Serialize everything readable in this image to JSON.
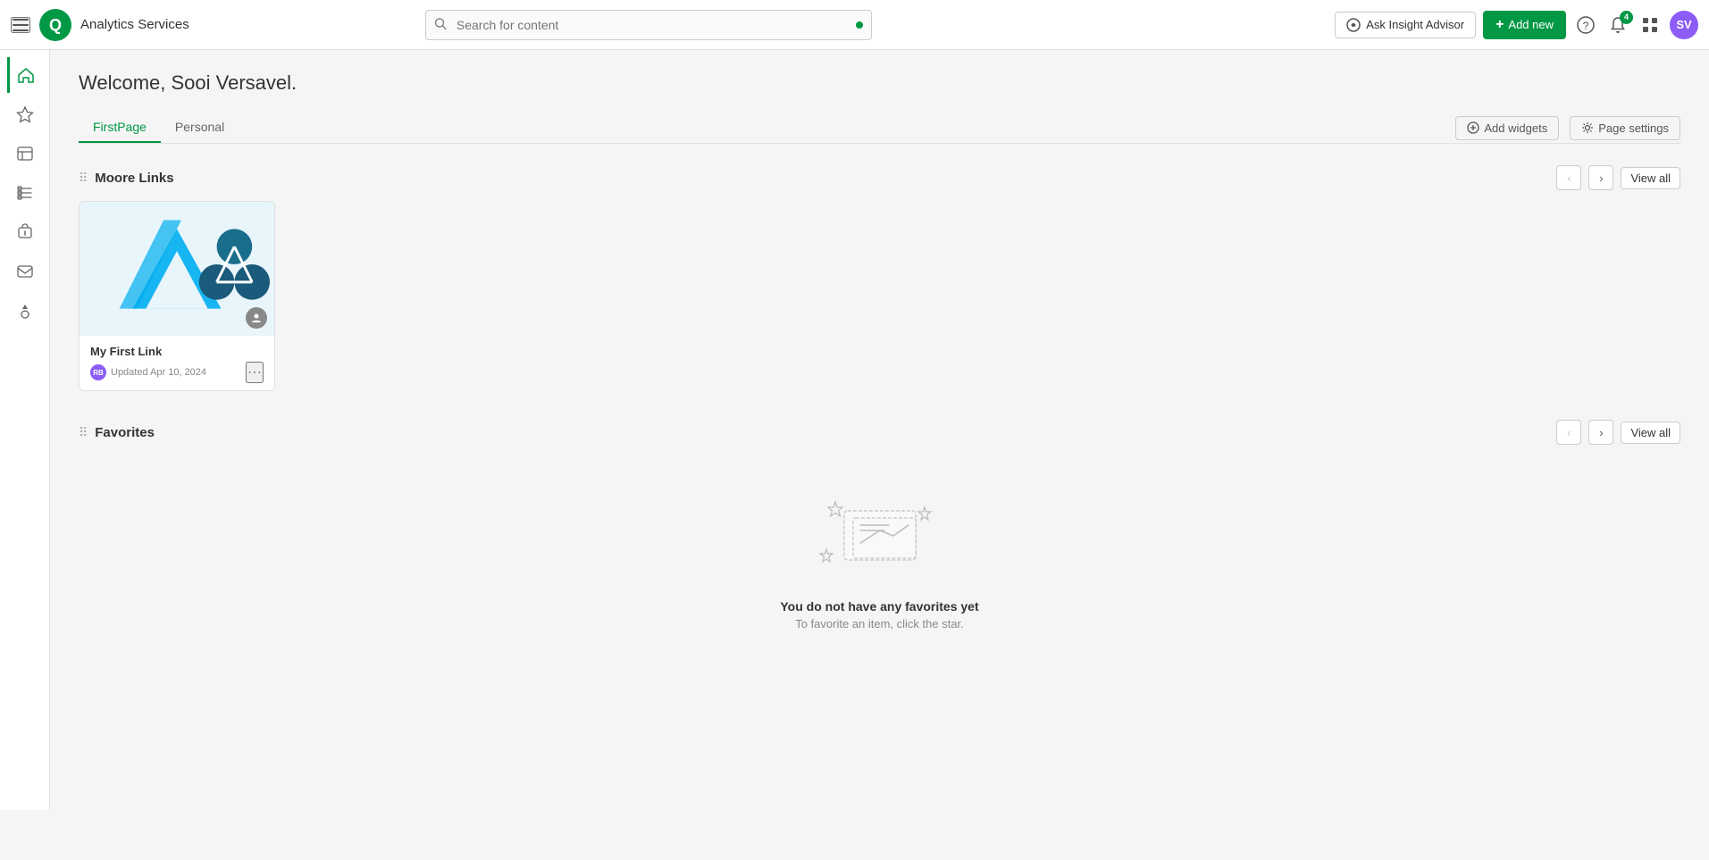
{
  "topnav": {
    "app_title": "Analytics Services",
    "search_placeholder": "Search for content",
    "insight_advisor_label": "Ask Insight Advisor",
    "add_new_label": "Add new",
    "notification_badge": "4",
    "avatar_initials": "SV"
  },
  "sidebar": {
    "items": [
      {
        "id": "home",
        "label": "Home",
        "icon": "⌂",
        "active": true
      },
      {
        "id": "starred",
        "label": "Starred",
        "icon": "☆",
        "active": false
      },
      {
        "id": "catalog",
        "label": "Catalog",
        "icon": "▦",
        "active": false
      },
      {
        "id": "collections",
        "label": "Collections",
        "icon": "🔖",
        "active": false
      },
      {
        "id": "alerts",
        "label": "Alerts",
        "icon": "🔔",
        "active": false
      },
      {
        "id": "subscriptions",
        "label": "Subscriptions",
        "icon": "✉",
        "active": false
      },
      {
        "id": "automations",
        "label": "Automations",
        "icon": "🚀",
        "active": false
      }
    ]
  },
  "main": {
    "welcome_text": "Welcome, Sooi Versavel.",
    "tabs": [
      {
        "id": "firstpage",
        "label": "FirstPage",
        "active": true
      },
      {
        "id": "personal",
        "label": "Personal",
        "active": false
      }
    ],
    "add_widgets_label": "Add widgets",
    "page_settings_label": "Page settings",
    "sections": {
      "moore_links": {
        "title": "Moore Links",
        "view_all_label": "View all",
        "cards": [
          {
            "id": "my-first-link",
            "title": "My First Link",
            "updated": "Updated Apr 10, 2024",
            "avatar_initials": "RB"
          }
        ]
      },
      "favorites": {
        "title": "Favorites",
        "view_all_label": "View all",
        "empty": true,
        "empty_text": "You do not have any favorites yet",
        "empty_sub": "To favorite an item, click the star."
      }
    }
  }
}
